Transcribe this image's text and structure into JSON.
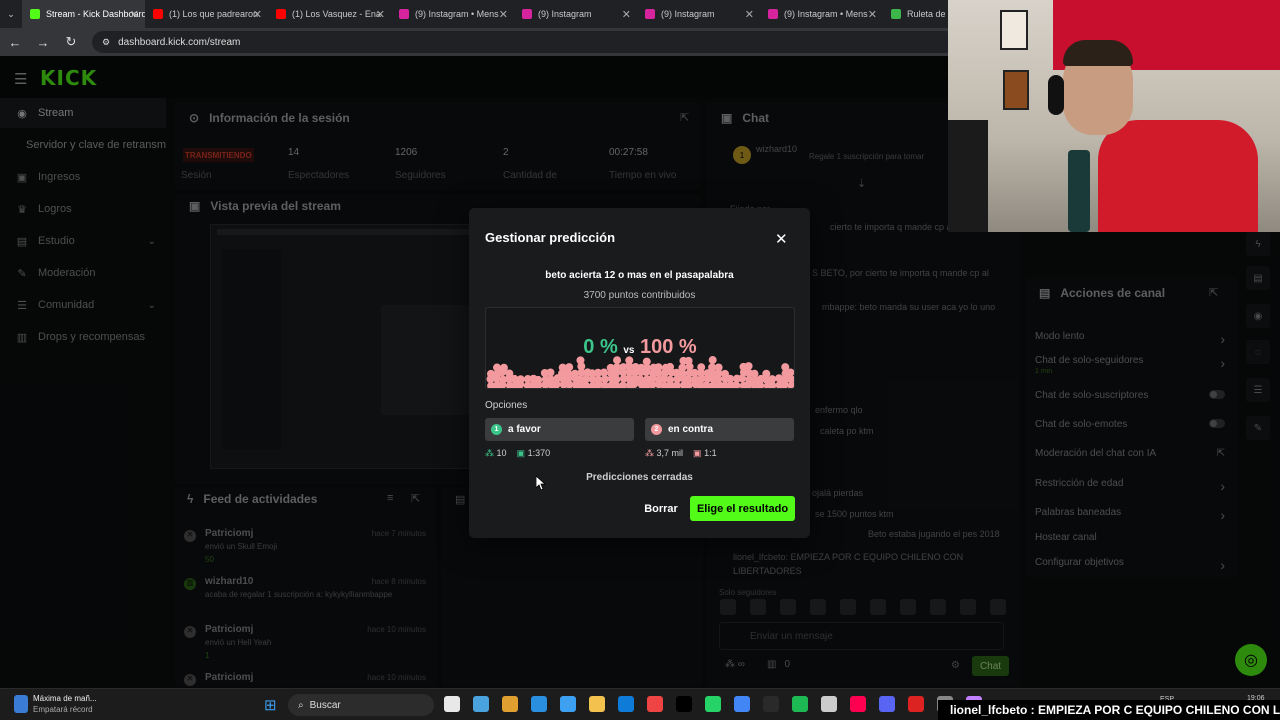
{
  "browser": {
    "tabs": [
      {
        "title": "Stream - Kick Dashboard",
        "color": "#53fc18",
        "active": true
      },
      {
        "title": "(1) Los que padrearon",
        "color": "#ff0000"
      },
      {
        "title": "(1) Los Vasquez - Ena",
        "color": "#ff0000"
      },
      {
        "title": "(9) Instagram • Mens",
        "color": "#d6249f"
      },
      {
        "title": "(9) Instagram",
        "color": "#d6249f"
      },
      {
        "title": "(9) Instagram",
        "color": "#d6249f"
      },
      {
        "title": "(9) Instagram • Mens",
        "color": "#d6249f"
      },
      {
        "title": "Ruleta de F",
        "color": "#3cb54a"
      }
    ],
    "url": "dashboard.kick.com/stream"
  },
  "app": {
    "logo": "KICK",
    "sidebar": [
      {
        "label": "Stream",
        "icon": "stream-icon",
        "active": true
      },
      {
        "label": "Servidor y clave de retransm",
        "icon": ""
      },
      {
        "label": "Ingresos",
        "icon": "money-icon"
      },
      {
        "label": "Logros",
        "icon": "trophy-icon"
      },
      {
        "label": "Estudio",
        "icon": "studio-icon",
        "chevron": true
      },
      {
        "label": "Moderación",
        "icon": "wrench-icon"
      },
      {
        "label": "Comunidad",
        "icon": "community-icon",
        "chevron": true
      },
      {
        "label": "Drops y recompensas",
        "icon": "drops-icon"
      }
    ],
    "session": {
      "title": "Información de la sesión",
      "live_badge": "TRANSMITIENDO",
      "stats": [
        {
          "value": "",
          "label": "Sesión"
        },
        {
          "value": "14",
          "label": "Espectadores"
        },
        {
          "value": "1206",
          "label": "Seguidores"
        },
        {
          "value": "2",
          "label": "Cantidad de"
        },
        {
          "value": "00:27:58",
          "label": "Tiempo en vivo"
        }
      ]
    },
    "preview_title": "Vista previa del stream",
    "feed": {
      "title": "Feed de actividades",
      "items": [
        {
          "user": "Patriciomj",
          "time": "hace 7 minutos",
          "text": "envió un Skull Emoji",
          "extra": "50"
        },
        {
          "user": "wizhard10",
          "time": "hace 8 minutos",
          "text": "acaba de regalar 1 suscripción a: kykykyllianmbappe",
          "extra": ""
        },
        {
          "user": "Patriciomj",
          "time": "hace 10 minutos",
          "text": "envió un Hell Yeah",
          "extra": "1"
        },
        {
          "user": "Patriciomj",
          "time": "hace 10 minutos",
          "text": "",
          "extra": ""
        }
      ]
    },
    "chat": {
      "title": "Chat",
      "pinned_user": "wizhard10",
      "pinned_text": "Regale 1 suscripción para tomar",
      "lines": [
        "Fijado por",
        "cierto te importa q mande cp a",
        "S BETO, por cierto te importa q mande cp al",
        "mbappe: beto manda su user aca yo lo uno",
        "enfermo qlo",
        "caleta po ktm",
        "ojalá pierdas",
        "se 1500 puntos ktm",
        "Beto estaba jugando el pes 2018",
        "lionel_lfcbeto: EMPIEZA POR C EQUIPO CHILENO CON LIBERTADORES"
      ],
      "followers_only": "Solo seguidores",
      "input_placeholder": "Enviar un mensaje",
      "send_label": "Chat",
      "points": "0"
    },
    "channel_actions": {
      "title": "Acciones de canal",
      "items": [
        {
          "label": "Modo lento",
          "control": "chevron"
        },
        {
          "label": "Chat de solo-seguidores",
          "sub": "1 min",
          "control": "chevron"
        },
        {
          "label": "Chat de solo-suscriptores",
          "control": "toggle"
        },
        {
          "label": "Chat de solo-emotes",
          "control": "toggle"
        },
        {
          "label": "Moderación del chat con IA",
          "control": "link"
        },
        {
          "label": "Restricción de edad",
          "control": "chevron"
        },
        {
          "label": "Palabras baneadas",
          "control": "chevron"
        },
        {
          "label": "Hostear canal",
          "control": ""
        },
        {
          "label": "Configurar objetivos",
          "control": "chevron"
        }
      ]
    }
  },
  "modal": {
    "title": "Gestionar predicción",
    "question": "beto acierta 12 o mas en el pasapalabra",
    "points": "3700 puntos contribuidos",
    "percent_favor": "0 %",
    "vs": "vs",
    "percent_contra": "100 %",
    "favor_share": 0,
    "contra_share": 1,
    "options_label": "Opciones",
    "options": [
      {
        "num": "1",
        "label": "a favor",
        "color": "#3cc58a",
        "count": "10",
        "ratio": "1:370"
      },
      {
        "num": "2",
        "label": "en contra",
        "color": "#f29a9e",
        "count": "3,7 mil",
        "ratio": "1:1"
      }
    ],
    "status": "Predicciones cerradas",
    "delete_label": "Borrar",
    "choose_label": "Elige el resultado"
  },
  "taskbar": {
    "notif_title": "Máxima de mañ...",
    "notif_sub": "Empatará récord",
    "search": "Buscar",
    "lang": "ESP",
    "time": "19:06"
  },
  "ticker": "lionel_lfcbeto : EMPIEZA POR C EQUIPO CHILENO CON LIB",
  "colors": {
    "kick_green": "#53fc18",
    "favor": "#3cc58a",
    "contra": "#f29a9e",
    "live_red": "#d9412f"
  }
}
